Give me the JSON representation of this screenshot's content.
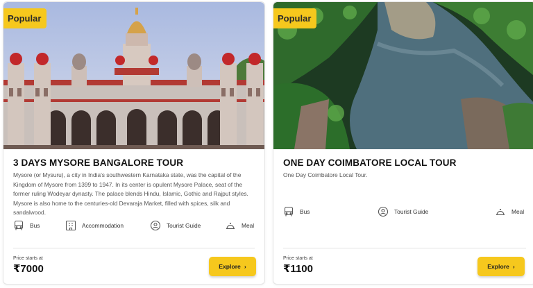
{
  "cards": [
    {
      "badge": "Popular",
      "title": "3 DAYS MYSORE BANGALORE TOUR",
      "description": "Mysore (or Mysuru), a city in India's southwestern Karnataka state, was the capital of the Kingdom of Mysore from 1399 to 1947. In its center is opulent Mysore Palace, seat of the former ruling Wodeyar dynasty. The palace blends Hindu, Islamic, Gothic and Rajput styles. Mysore is also home to the centuries-old Devaraja Market, filled with spices, silk and sandalwood.",
      "features": [
        {
          "label": "Bus",
          "icon": "bus-icon"
        },
        {
          "label": "Accommodation",
          "icon": "building-icon"
        },
        {
          "label": "Tourist Guide",
          "icon": "guide-icon"
        },
        {
          "label": "Meal",
          "icon": "cloche-icon"
        }
      ],
      "price_label": "Price starts at",
      "price": "₹7000",
      "explore_label": "Explore",
      "image": "mysore-palace"
    },
    {
      "badge": "Popular",
      "title": "ONE DAY COIMBATORE LOCAL TOUR",
      "description": "One Day Coimbatore Local Tour.",
      "features": [
        {
          "label": "Bus",
          "icon": "bus-icon"
        },
        {
          "label": "Tourist Guide",
          "icon": "guide-icon"
        },
        {
          "label": "Meal",
          "icon": "cloche-icon"
        }
      ],
      "price_label": "Price starts at",
      "price": "₹1100",
      "explore_label": "Explore",
      "image": "river-landscape"
    }
  ],
  "colors": {
    "accent": "#f6c81d",
    "title": "#111111",
    "text": "#555555"
  }
}
